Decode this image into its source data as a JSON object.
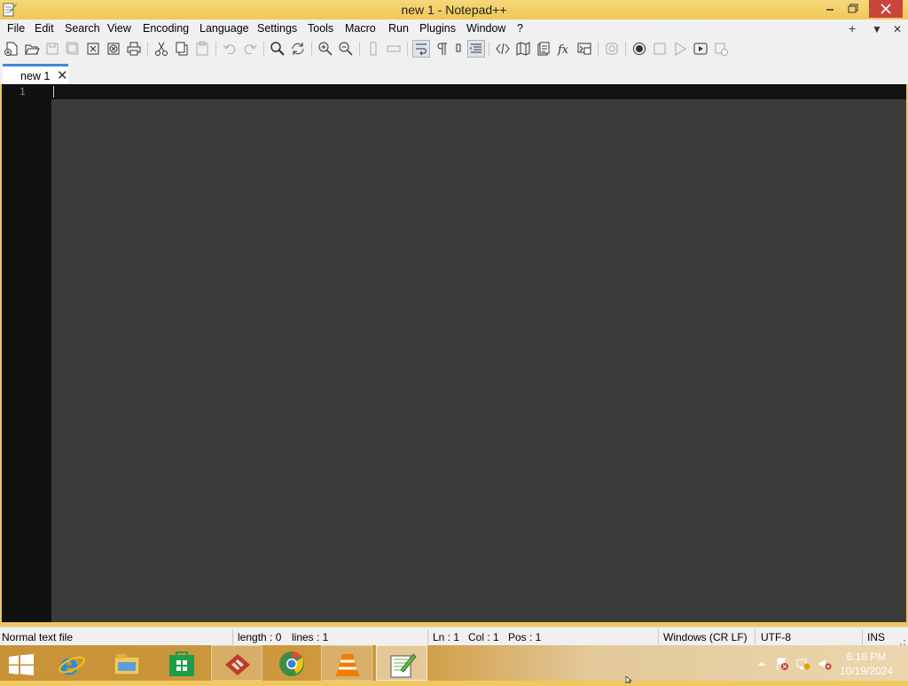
{
  "window": {
    "title": "new 1 - Notepad++"
  },
  "menu": [
    "File",
    "Edit",
    "Search",
    "View",
    "Encoding",
    "Language",
    "Settings",
    "Tools",
    "Macro",
    "Run",
    "Plugins",
    "Window",
    "?"
  ],
  "menu_right": {
    "add": "+",
    "dropdown": "▼",
    "close": "✕"
  },
  "toolbar_icons": [
    "new-file-icon",
    "open-file-icon",
    "save-icon",
    "save-all-icon",
    "close-icon",
    "close-all-icon",
    "print-icon",
    "cut-icon",
    "copy-icon",
    "paste-icon",
    "undo-icon",
    "redo-icon",
    "find-icon",
    "replace-icon",
    "zoom-in-icon",
    "zoom-out-icon",
    "sync-vertical-icon",
    "sync-horizontal-icon",
    "word-wrap-icon",
    "show-all-chars-icon",
    "indent-guide-icon",
    "document-map-icon",
    "user-defined-language-icon",
    "folder-as-workspace-icon",
    "function-list-icon",
    "document-list-icon",
    "monitoring-icon",
    "record-macro-icon",
    "stop-macro-icon",
    "play-macro-icon",
    "run-macro-multiple-icon",
    "save-macro-icon"
  ],
  "tabs": [
    {
      "label": "new 1",
      "close": "✕"
    }
  ],
  "editor": {
    "line_numbers": [
      "1"
    ]
  },
  "status": {
    "file_type": "Normal text file",
    "length": "length : 0",
    "lines": "lines : 1",
    "ln": "Ln : 1",
    "col": "Col : 1",
    "pos": "Pos : 1",
    "eol": "Windows (CR LF)",
    "encoding": "UTF-8",
    "mode": "INS"
  },
  "taskbar": {
    "apps": [
      "internet-explorer-icon",
      "file-explorer-icon",
      "store-icon",
      "filezilla-icon",
      "chrome-icon",
      "vlc-icon",
      "notepad-plus-plus-icon"
    ],
    "clock_time": "6:16 PM",
    "clock_date": "10/19/2024"
  },
  "colors": {
    "titlebar": "#f0c858",
    "close_button": "#c7463b",
    "tab_accent": "#3d8bd6",
    "editor_bg": "#3b3b3b",
    "gutter_bg": "#111111"
  }
}
